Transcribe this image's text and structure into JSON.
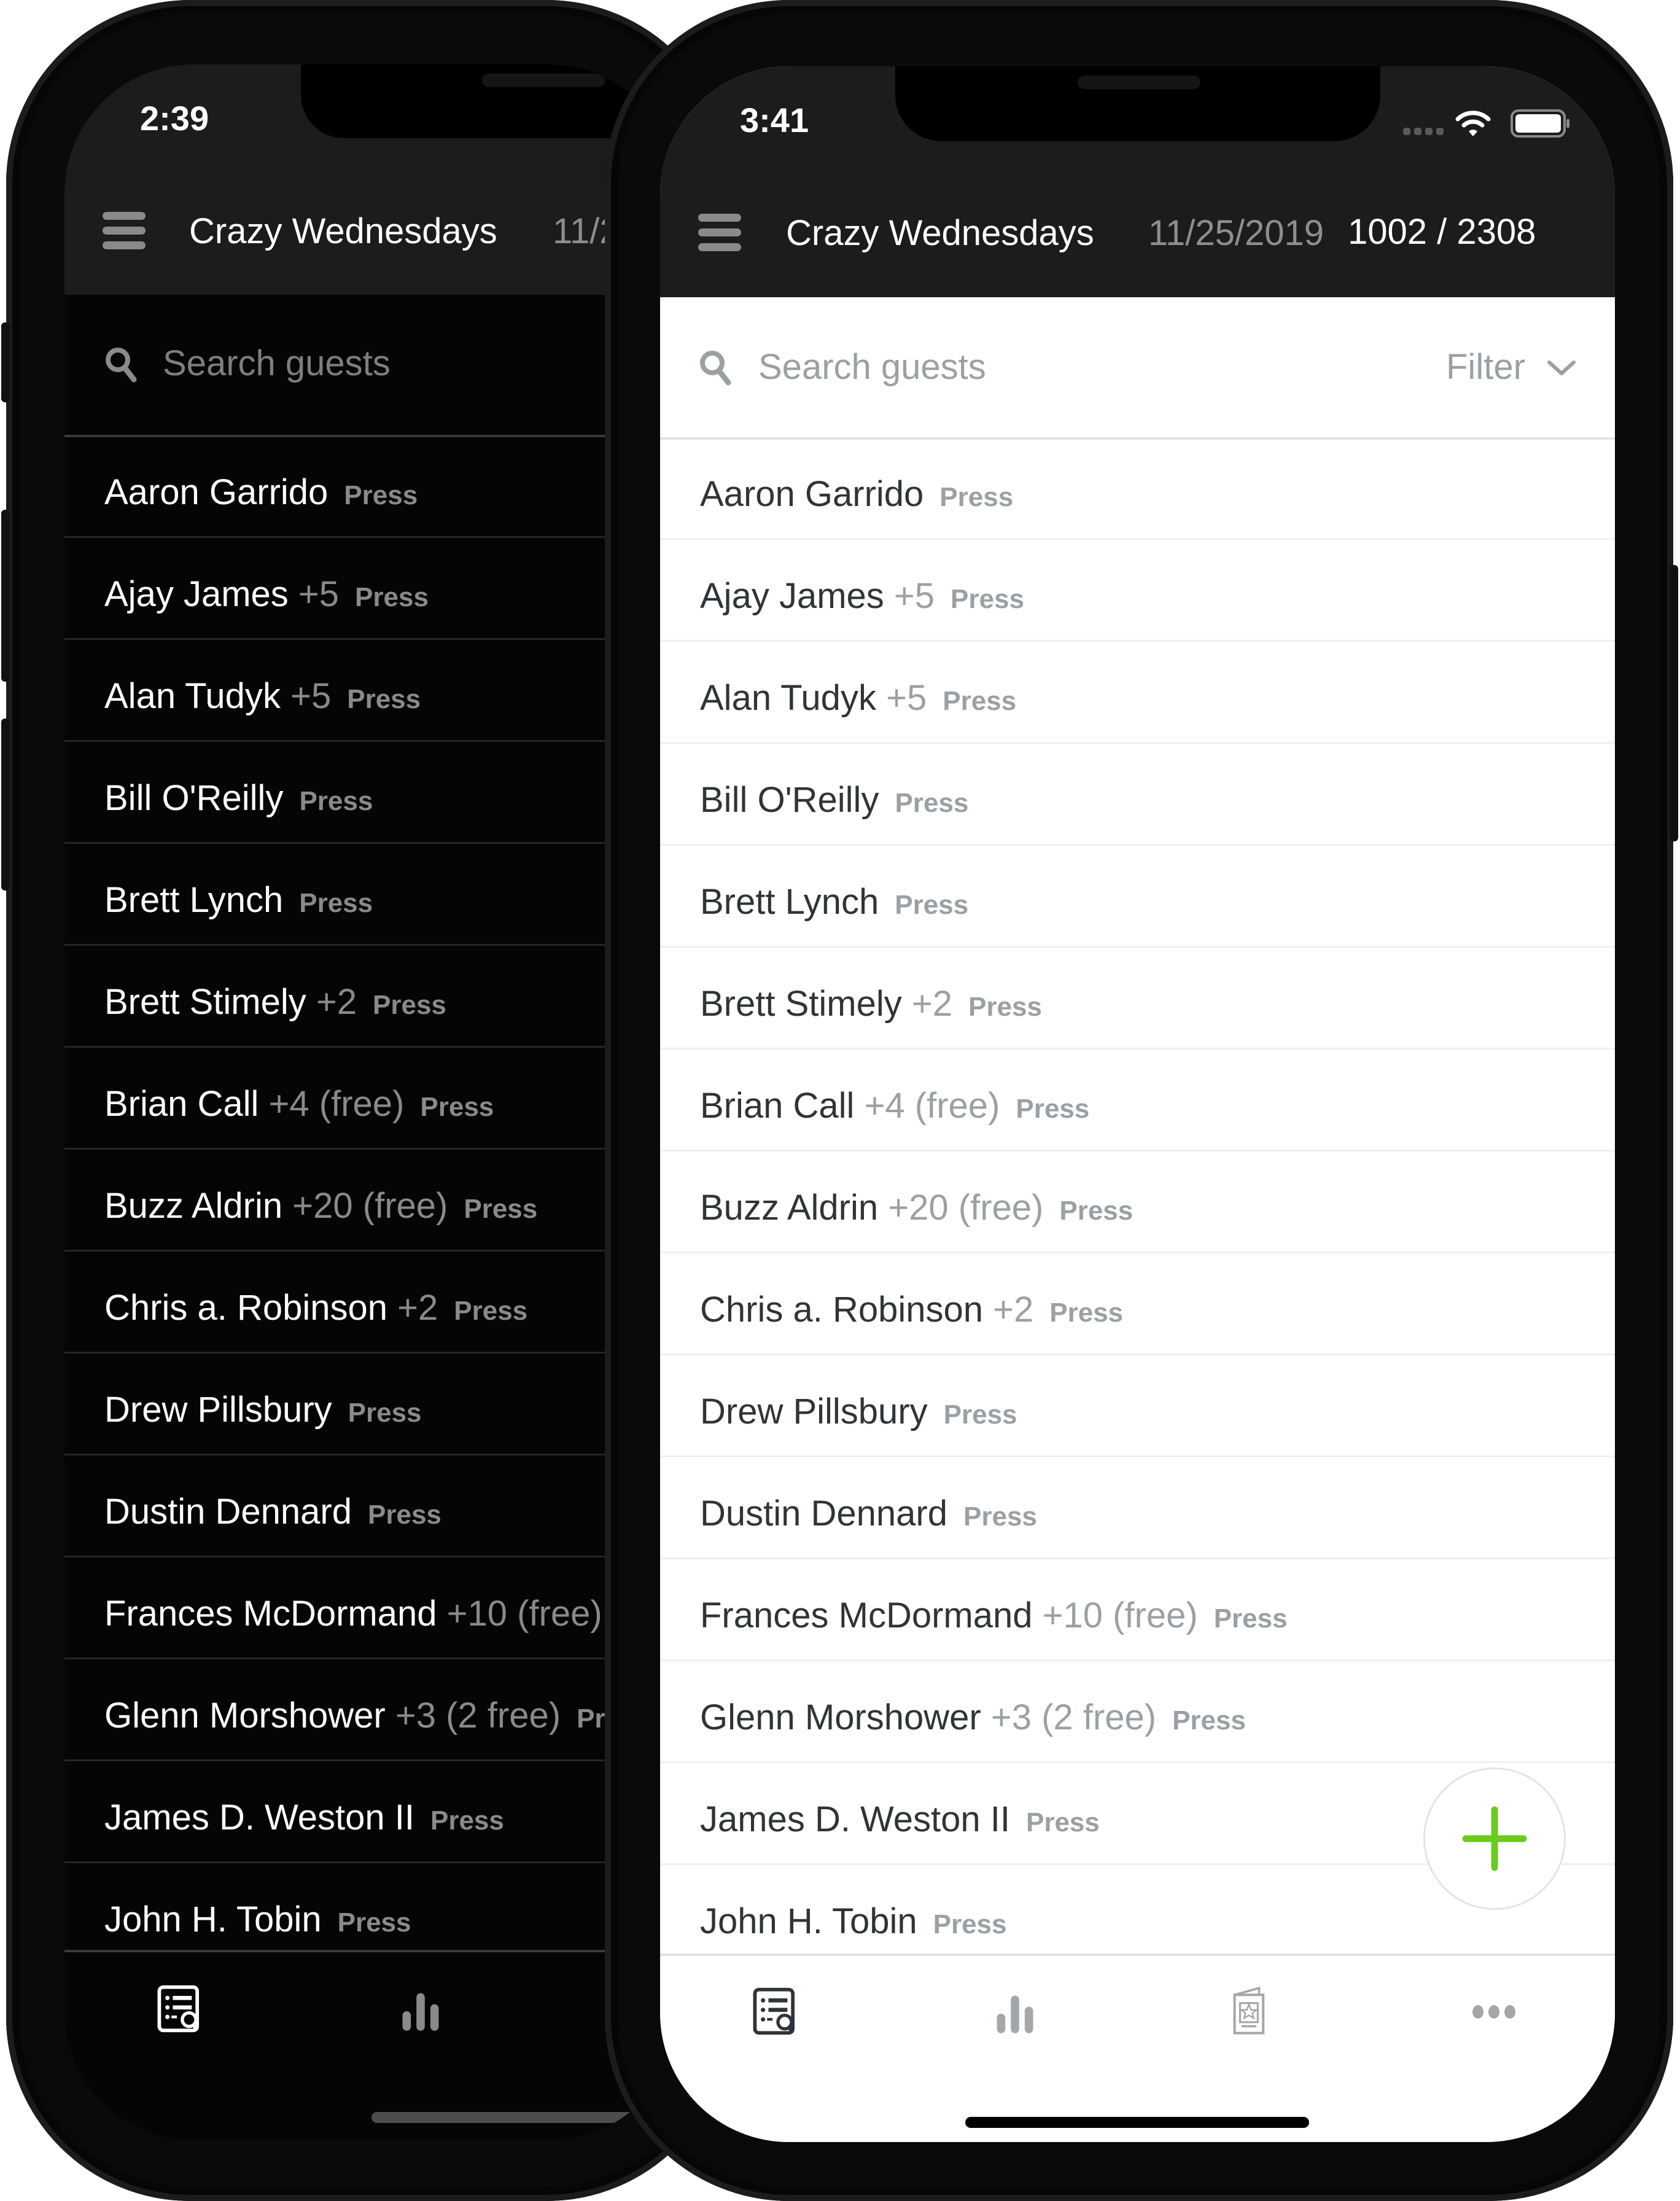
{
  "app": {
    "event_title": "Crazy Wednesdays",
    "event_date": "11/25/2019",
    "checked_in_count": "1002 / 2308",
    "search_placeholder": "Search guests",
    "filter_label": "Filter",
    "accent_color": "#6acb1d"
  },
  "phone_dark": {
    "status_time": "2:39",
    "header_date_truncated": "11/2",
    "tabs": [
      {
        "icon": "guest-list-search-icon",
        "active": true
      },
      {
        "icon": "bar-chart-icon",
        "active": false
      }
    ]
  },
  "phone_light": {
    "status_time": "3:41",
    "status_icons": [
      "signal-dots-icon",
      "wifi-icon",
      "battery-icon"
    ],
    "tabs": [
      {
        "icon": "guest-list-search-icon",
        "active": true
      },
      {
        "icon": "bar-chart-icon",
        "active": false
      },
      {
        "icon": "ticket-star-icon",
        "active": false
      },
      {
        "icon": "more-dots-icon",
        "active": false
      }
    ],
    "fab_icon": "plus-icon"
  },
  "guests": [
    {
      "name": "Aaron Garrido",
      "extra": "",
      "tag": "Press"
    },
    {
      "name": "Ajay James",
      "extra": "+5",
      "tag": "Press"
    },
    {
      "name": "Alan Tudyk",
      "extra": "+5",
      "tag": "Press"
    },
    {
      "name": "Bill O'Reilly",
      "extra": "",
      "tag": "Press"
    },
    {
      "name": "Brett Lynch",
      "extra": "",
      "tag": "Press"
    },
    {
      "name": "Brett Stimely",
      "extra": "+2",
      "tag": "Press"
    },
    {
      "name": "Brian Call",
      "extra": "+4 (free)",
      "tag": "Press"
    },
    {
      "name": "Buzz Aldrin",
      "extra": "+20 (free)",
      "tag": "Press"
    },
    {
      "name": "Chris a. Robinson",
      "extra": "+2",
      "tag": "Press"
    },
    {
      "name": "Drew Pillsbury",
      "extra": "",
      "tag": "Press"
    },
    {
      "name": "Dustin Dennard",
      "extra": "",
      "tag": "Press"
    },
    {
      "name": "Frances McDormand",
      "extra": "+10 (free)",
      "tag": "Press"
    },
    {
      "name": "Glenn Morshower",
      "extra": "+3 (2 free)",
      "tag": "Press"
    },
    {
      "name": "James D. Weston II",
      "extra": "",
      "tag": "Press"
    },
    {
      "name": "John H. Tobin",
      "extra": "",
      "tag": "Press"
    }
  ]
}
